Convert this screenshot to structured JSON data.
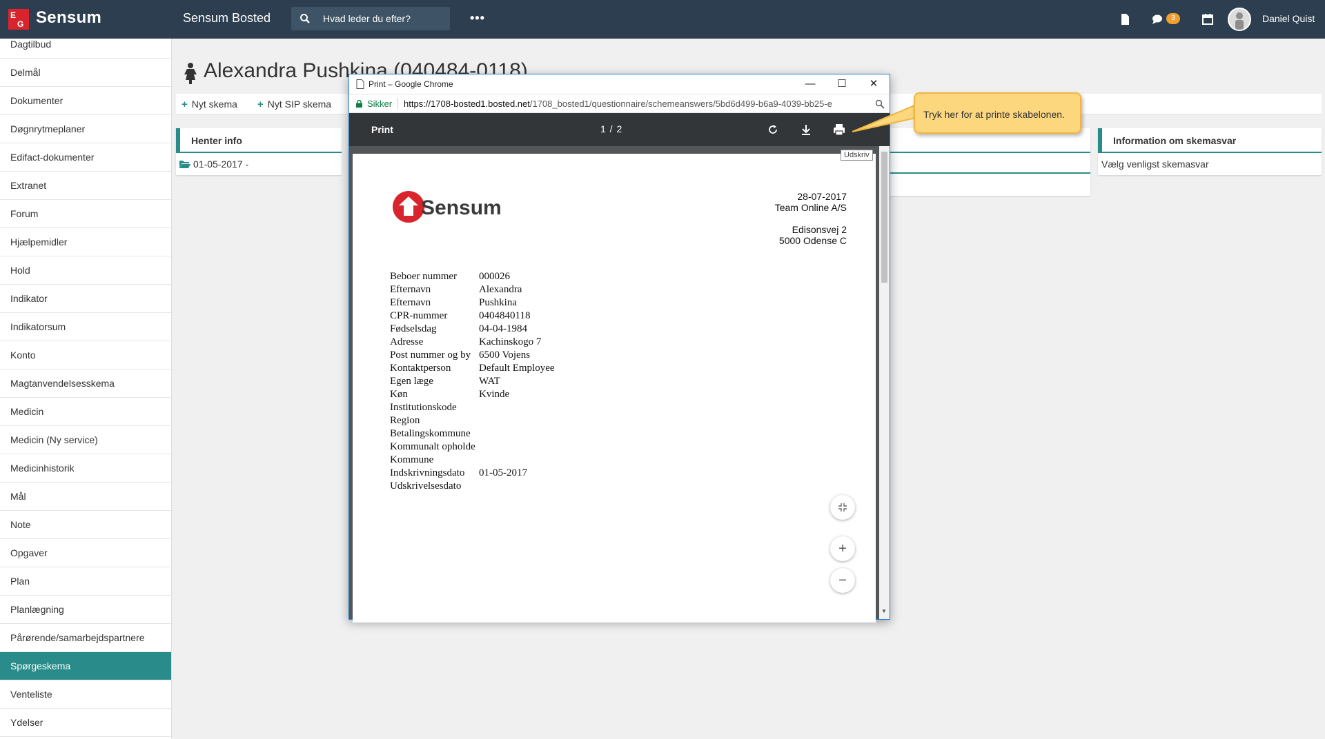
{
  "topbar": {
    "logo_text": "Sensum",
    "app_title": "Sensum Bosted",
    "search_placeholder": "Hvad leder du efter?",
    "more_label": "•••",
    "messages_count": "3",
    "user_name": "Daniel Quist"
  },
  "sidebar": {
    "items": [
      {
        "label": "Dagtilbud",
        "active": false
      },
      {
        "label": "Delmål",
        "active": false
      },
      {
        "label": "Dokumenter",
        "active": false
      },
      {
        "label": "Døgnrytmeplaner",
        "active": false
      },
      {
        "label": "Edifact-dokumenter",
        "active": false
      },
      {
        "label": "Extranet",
        "active": false
      },
      {
        "label": "Forum",
        "active": false
      },
      {
        "label": "Hjælpemidler",
        "active": false
      },
      {
        "label": "Hold",
        "active": false
      },
      {
        "label": "Indikator",
        "active": false
      },
      {
        "label": "Indikatorsum",
        "active": false
      },
      {
        "label": "Konto",
        "active": false
      },
      {
        "label": "Magtanvendelsesskema",
        "active": false
      },
      {
        "label": "Medicin",
        "active": false
      },
      {
        "label": "Medicin (Ny service)",
        "active": false
      },
      {
        "label": "Medicinhistorik",
        "active": false
      },
      {
        "label": "Mål",
        "active": false
      },
      {
        "label": "Note",
        "active": false
      },
      {
        "label": "Opgaver",
        "active": false
      },
      {
        "label": "Plan",
        "active": false
      },
      {
        "label": "Planlægning",
        "active": false
      },
      {
        "label": "Pårørende/samarbejdspartnere",
        "active": false
      },
      {
        "label": "Spørgeskema",
        "active": true
      },
      {
        "label": "Venteliste",
        "active": false
      },
      {
        "label": "Ydelser",
        "active": false
      }
    ]
  },
  "page": {
    "title": "Alexandra Pushkina (040484-0118)",
    "new_scheme": "Nyt skema",
    "new_sip_scheme": "Nyt SIP skema"
  },
  "panels": {
    "left_title": "Henter info",
    "left_item": "01-05-2017 -",
    "right_title": "Information om skemasvar",
    "right_item": "Vælg venligst skemasvar"
  },
  "chrome": {
    "window_title": "Print – Google Chrome",
    "secure_label": "Sikker",
    "url_host": "https://1708-bosted1.bosted.net",
    "url_path": "/1708_bosted1/questionnaire/schemeanswers/5bd6d499-b6a9-4039-bb25-e",
    "pdf_label": "Print",
    "pages": "1 / 2",
    "print_tooltip": "Udskriv"
  },
  "document": {
    "logo_text": "Sensum",
    "date": "28-07-2017",
    "company": "Team Online A/S",
    "street": "Edisonsvej 2",
    "city": "5000 Odense C",
    "fields": [
      {
        "key": "Beboer nummer",
        "value": "000026"
      },
      {
        "key": "Efternavn",
        "value": "Alexandra"
      },
      {
        "key": "Efternavn",
        "value": "Pushkina"
      },
      {
        "key": "CPR-nummer",
        "value": "0404840118"
      },
      {
        "key": "Fødselsdag",
        "value": "04-04-1984"
      },
      {
        "key": "Adresse",
        "value": "Kachinskogo 7"
      },
      {
        "key": "Post nummer og by",
        "value": "6500 Vojens"
      },
      {
        "key": "Kontaktperson",
        "value": "Default Employee"
      },
      {
        "key": "Egen læge",
        "value": "WAT"
      },
      {
        "key": "Køn",
        "value": "Kvinde"
      },
      {
        "key": "Institutionskode",
        "value": ""
      },
      {
        "key": "Region",
        "value": ""
      },
      {
        "key": "Betalingskommune",
        "value": ""
      },
      {
        "key": "Kommunalt opholde",
        "value": ""
      },
      {
        "key": "Kommune",
        "value": ""
      },
      {
        "key": "Indskrivningsdato",
        "value": "01-05-2017"
      },
      {
        "key": "Udskrivelsesdato",
        "value": ""
      }
    ]
  },
  "callout": {
    "text": "Tryk her for at printe skabelonen."
  },
  "colors": {
    "topbar": "#2c3e4f",
    "accent": "#2a8b8b",
    "badge": "#f0a030",
    "callout": "#fcd77e"
  }
}
